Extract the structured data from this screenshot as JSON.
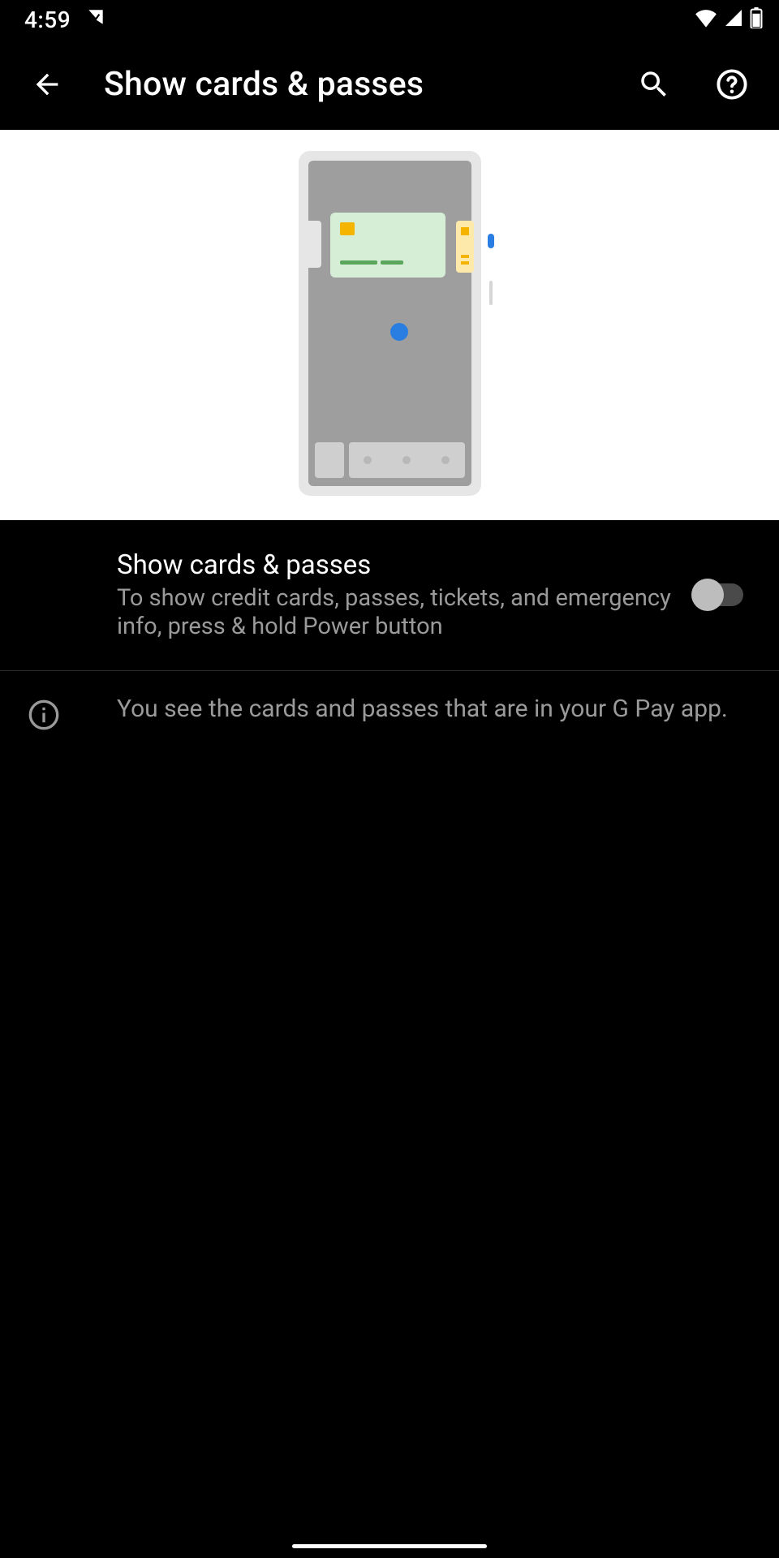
{
  "status": {
    "time": "4:59"
  },
  "header": {
    "title": "Show cards & passes"
  },
  "setting": {
    "title": "Show cards & passes",
    "subtitle": "To show credit cards, passes, tickets, and emergency info, press & hold Power button",
    "enabled": false
  },
  "info": {
    "text": "You see the cards and passes that are in your G Pay app."
  }
}
